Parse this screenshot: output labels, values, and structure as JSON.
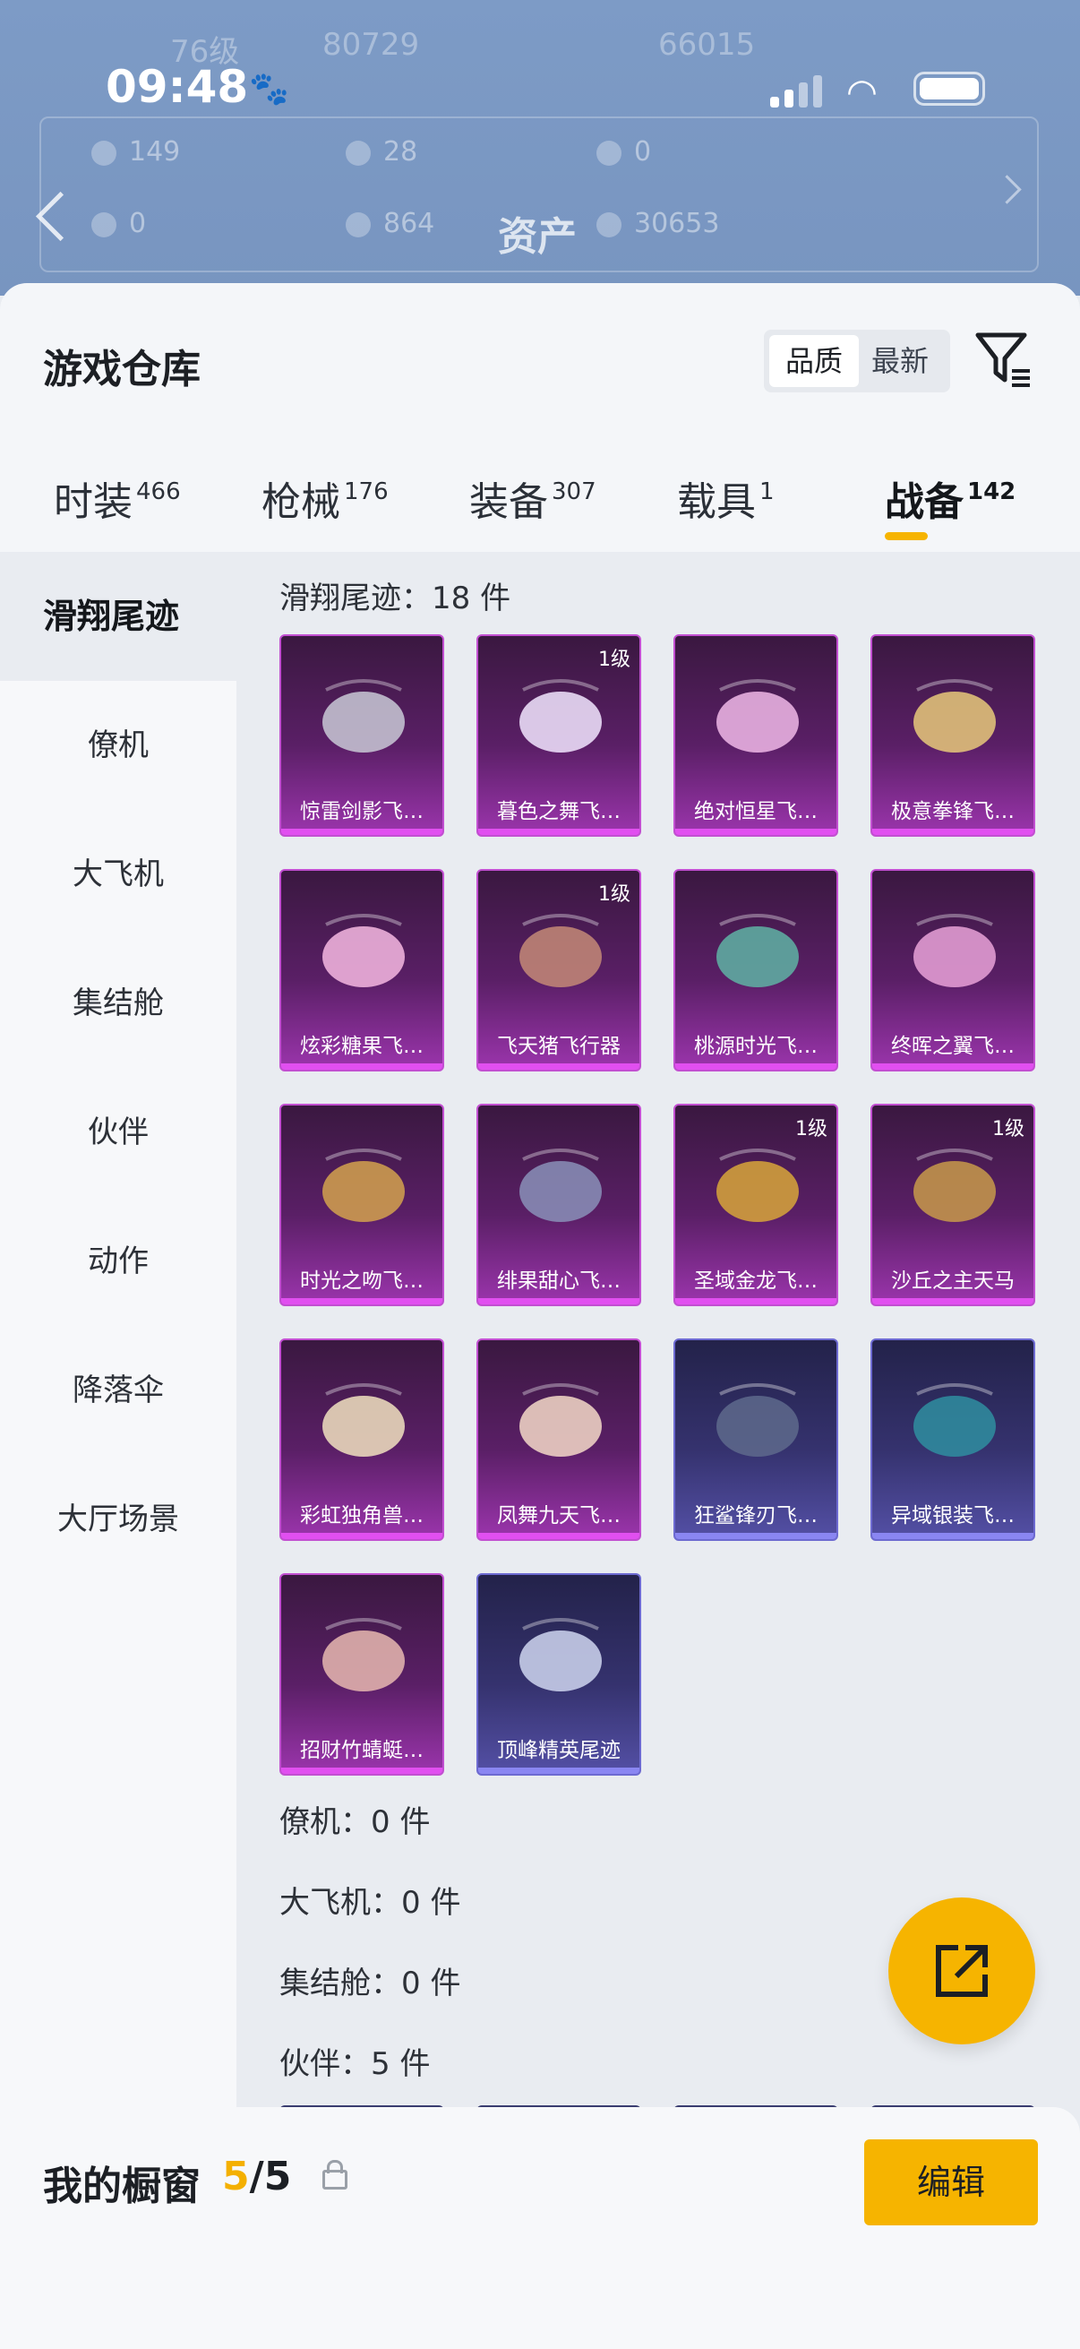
{
  "status_bar": {
    "time": "09:48",
    "paw_icon": "paw-icon"
  },
  "background_header": {
    "faint_level": "76级",
    "faint_score": "80729",
    "faint_score2": "66015",
    "stats": [
      "149",
      "28",
      "0",
      "0",
      "864",
      "30653"
    ],
    "title": "资产"
  },
  "sheet": {
    "title": "游戏仓库",
    "sort": {
      "quality": "品质",
      "latest": "最新"
    }
  },
  "tabs": [
    {
      "label": "时装",
      "count": "466"
    },
    {
      "label": "枪械",
      "count": "176"
    },
    {
      "label": "装备",
      "count": "307"
    },
    {
      "label": "载具",
      "count": "1"
    },
    {
      "label": "战备",
      "count": "142"
    }
  ],
  "sidebar": [
    {
      "label": "滑翔尾迹"
    },
    {
      "label": "僚机"
    },
    {
      "label": "大飞机"
    },
    {
      "label": "集结舱"
    },
    {
      "label": "伙伴"
    },
    {
      "label": "动作"
    },
    {
      "label": "降落伞"
    },
    {
      "label": "大厅场景"
    }
  ],
  "sections": {
    "glide_trail": "滑翔尾迹：18 件",
    "wingman": "僚机：0 件",
    "big_plane": "大飞机：0 件",
    "pod": "集结舱：0 件",
    "partner": "伙伴：5 件"
  },
  "items": [
    {
      "name": "惊雷剑影飞…",
      "level": "",
      "rarity": "purple"
    },
    {
      "name": "暮色之舞飞…",
      "level": "1级",
      "rarity": "purple"
    },
    {
      "name": "绝对恒星飞…",
      "level": "",
      "rarity": "purple"
    },
    {
      "name": "极意拳锋飞…",
      "level": "",
      "rarity": "purple"
    },
    {
      "name": "炫彩糖果飞…",
      "level": "",
      "rarity": "purple"
    },
    {
      "name": "飞天猪飞行器",
      "level": "1级",
      "rarity": "purple"
    },
    {
      "name": "桃源时光飞…",
      "level": "",
      "rarity": "purple"
    },
    {
      "name": "终晖之翼飞…",
      "level": "",
      "rarity": "purple"
    },
    {
      "name": "时光之吻飞…",
      "level": "",
      "rarity": "purple"
    },
    {
      "name": "绯果甜心飞…",
      "level": "",
      "rarity": "purple"
    },
    {
      "name": "圣域金龙飞…",
      "level": "1级",
      "rarity": "purple"
    },
    {
      "name": "沙丘之主天马",
      "level": "1级",
      "rarity": "purple"
    },
    {
      "name": "彩虹独角兽…",
      "level": "",
      "rarity": "purple"
    },
    {
      "name": "凤舞九天飞…",
      "level": "",
      "rarity": "purple"
    },
    {
      "name": "狂鲨锋刃飞…",
      "level": "",
      "rarity": "blue"
    },
    {
      "name": "异域银装飞…",
      "level": "",
      "rarity": "blue"
    },
    {
      "name": "招财竹蜻蜓…",
      "level": "",
      "rarity": "purple"
    },
    {
      "name": "顶峰精英尾迹",
      "level": "",
      "rarity": "blue"
    }
  ],
  "showcase": {
    "title": "我的橱窗",
    "current": "5",
    "total": "/5",
    "edit_label": "编辑"
  },
  "colors": {
    "accent": "#f6b400",
    "epic": "#c24fd1",
    "rare": "#6d6ad1"
  }
}
